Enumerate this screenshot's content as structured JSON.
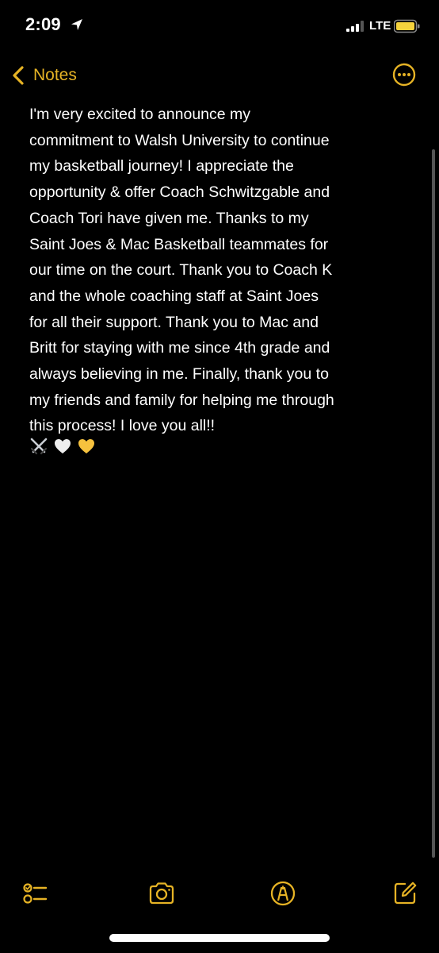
{
  "status_bar": {
    "time": "2:09",
    "network": "LTE",
    "location_icon": "location-arrow-icon",
    "signal_icon": "signal-bars-icon",
    "battery_icon": "battery-icon"
  },
  "nav": {
    "back_label": "Notes",
    "back_icon": "chevron-left-icon",
    "more_icon": "ellipsis-circle-icon"
  },
  "note": {
    "body": "I'm very excited to announce my\ncommitment to Walsh University to continue\nmy basketball journey! I appreciate the\nopportunity & offer Coach Schwitzgable and\nCoach Tori have given me. Thanks to my\nSaint Joes & Mac Basketball teammates for\nour time on the court. Thank you to Coach K\nand the whole coaching staff at Saint Joes\nfor all their support. Thank you to Mac and\nBritt for staying with me since 4th grade and\nalways believing in me. Finally, thank you to\nmy friends and family for helping me through\nthis process! I love you all!!",
    "emojis": [
      "crossed-swords-icon",
      "white-heart-icon",
      "yellow-heart-icon"
    ]
  },
  "toolbar": {
    "items": [
      "checklist-icon",
      "camera-icon",
      "markup-pen-icon",
      "compose-icon"
    ]
  },
  "colors": {
    "accent": "#e6b325",
    "background": "#000000",
    "text": "#ffffff"
  }
}
